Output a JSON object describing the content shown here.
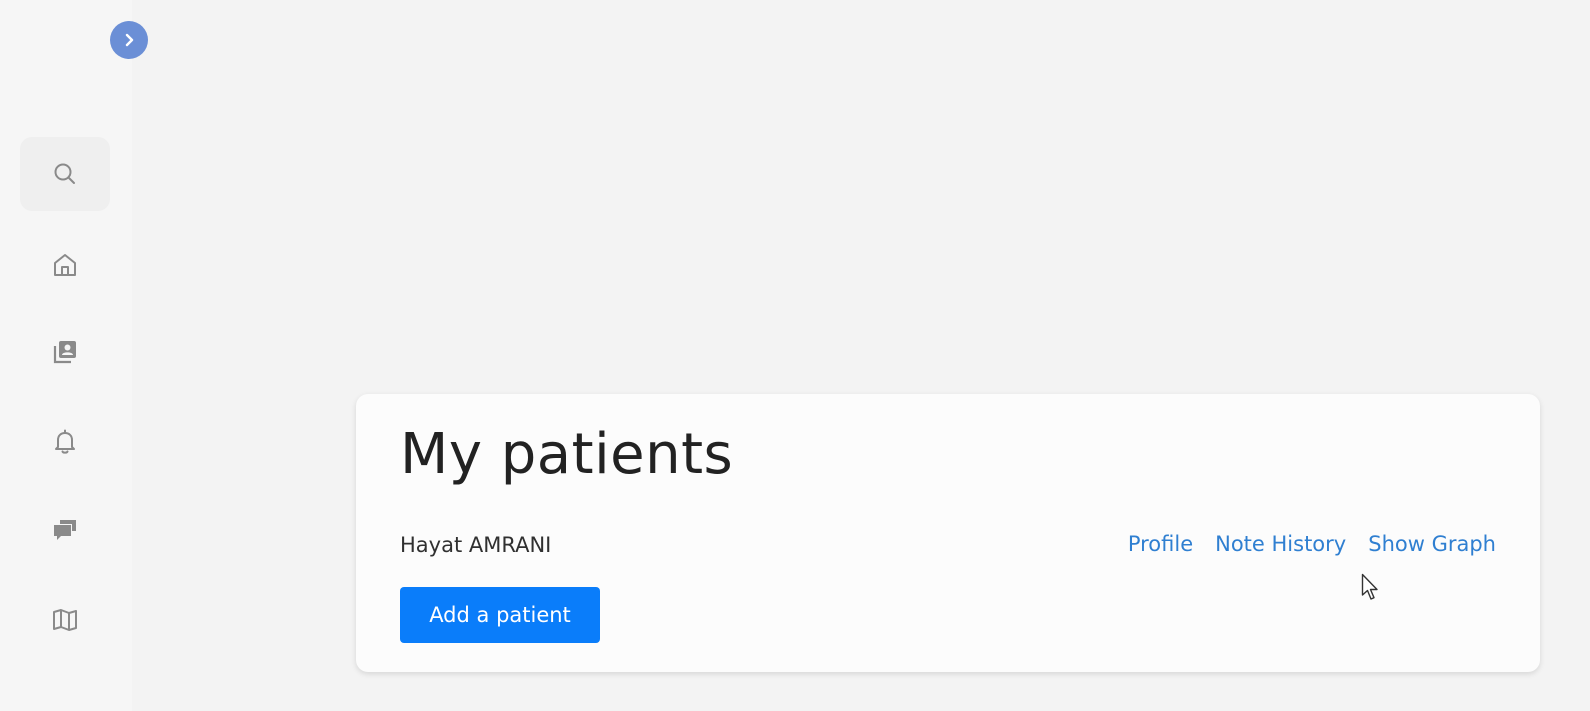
{
  "sidebar": {
    "expand_icon": "chevron-right-icon",
    "items": [
      {
        "name": "search",
        "icon": "search-icon",
        "active": true
      },
      {
        "name": "home",
        "icon": "home-icon",
        "active": false
      },
      {
        "name": "patients",
        "icon": "contact-list-icon",
        "active": false
      },
      {
        "name": "notifications",
        "icon": "bell-icon",
        "active": false
      },
      {
        "name": "messages",
        "icon": "chat-icon",
        "active": false
      },
      {
        "name": "map",
        "icon": "map-icon",
        "active": false
      }
    ]
  },
  "main": {
    "title": "My patients",
    "patients": [
      {
        "name": "Hayat AMRANI",
        "links": {
          "profile": "Profile",
          "note_history": "Note History",
          "show_graph": "Show Graph"
        }
      }
    ],
    "add_patient_label": "Add a patient"
  },
  "colors": {
    "accent": "#0a7dfa",
    "link": "#2f7fd1",
    "expand_button": "#6b8fd6",
    "background": "#f3f3f3",
    "card": "#fcfcfc"
  }
}
